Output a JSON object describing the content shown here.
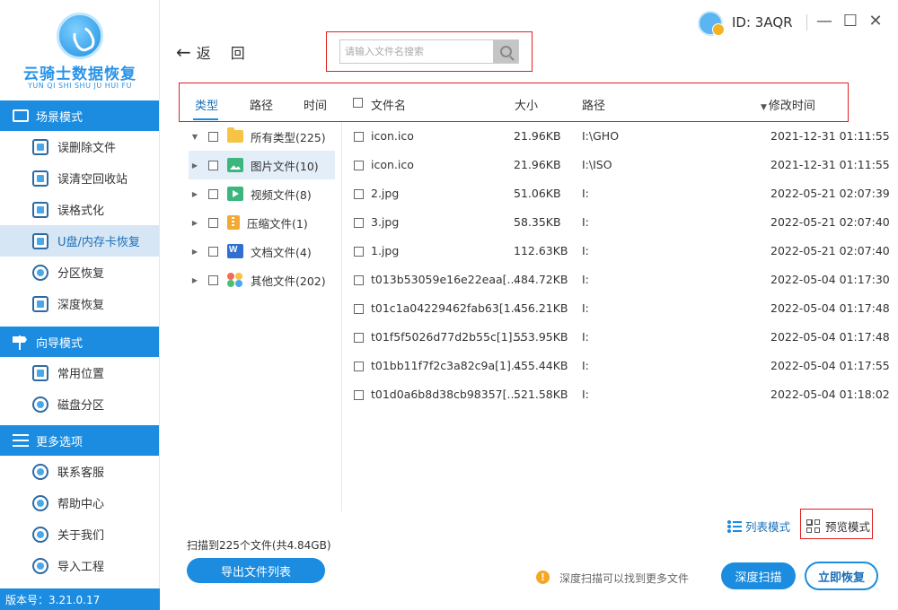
{
  "app": {
    "logo_title": "云骑士数据恢复",
    "logo_subtitle": "YUN QI SHI SHU JU HUI FU",
    "version": "版本号：3.21.0.17",
    "user_id": "ID: 3AQR"
  },
  "sidebar": {
    "sections": [
      {
        "title": "场景模式",
        "icon": "card-icon",
        "items": [
          {
            "label": "误删除文件",
            "icon": "deleted-file-icon",
            "active": false
          },
          {
            "label": "误清空回收站",
            "icon": "recycle-bin-icon",
            "active": false
          },
          {
            "label": "误格式化",
            "icon": "format-icon",
            "active": false
          },
          {
            "label": "U盘/内存卡恢复",
            "icon": "usb-card-icon",
            "active": true
          },
          {
            "label": "分区恢复",
            "icon": "partition-icon",
            "active": false
          },
          {
            "label": "深度恢复",
            "icon": "deep-recovery-icon",
            "active": false
          }
        ]
      },
      {
        "title": "向导模式",
        "icon": "signpost-icon",
        "items": [
          {
            "label": "常用位置",
            "icon": "common-location-icon",
            "active": false
          },
          {
            "label": "磁盘分区",
            "icon": "disk-partition-icon",
            "active": false
          }
        ]
      },
      {
        "title": "更多选项",
        "icon": "menu-icon",
        "items": [
          {
            "label": "联系客服",
            "icon": "customer-service-icon",
            "active": false
          },
          {
            "label": "帮助中心",
            "icon": "help-icon",
            "active": false
          },
          {
            "label": "关于我们",
            "icon": "info-icon",
            "active": false
          },
          {
            "label": "导入工程",
            "icon": "import-icon",
            "active": false
          }
        ]
      }
    ]
  },
  "toolbar": {
    "back_label": "返回",
    "search_placeholder": "请输入文件名搜索"
  },
  "filter_tabs": [
    "类型",
    "路径",
    "时间"
  ],
  "columns": {
    "name": "文件名",
    "size": "大小",
    "path": "路径",
    "modified": "修改时间"
  },
  "tree": [
    {
      "label": "所有类型(225)",
      "icon": "folder-icon",
      "expanded": true,
      "selected": false
    },
    {
      "label": "图片文件(10)",
      "icon": "image-icon",
      "expanded": false,
      "selected": true
    },
    {
      "label": "视频文件(8)",
      "icon": "video-icon",
      "expanded": false,
      "selected": false
    },
    {
      "label": "压缩文件(1)",
      "icon": "zip-icon",
      "expanded": false,
      "selected": false
    },
    {
      "label": "文档文件(4)",
      "icon": "document-icon",
      "expanded": false,
      "selected": false
    },
    {
      "label": "其他文件(202)",
      "icon": "other-files-icon",
      "expanded": false,
      "selected": false
    }
  ],
  "files": [
    {
      "name": "icon.ico",
      "size": "21.96KB",
      "path": "I:\\GHO",
      "modified": "2021-12-31 01:11:55"
    },
    {
      "name": "icon.ico",
      "size": "21.96KB",
      "path": "I:\\ISO",
      "modified": "2021-12-31 01:11:55"
    },
    {
      "name": "2.jpg",
      "size": "51.06KB",
      "path": "I:",
      "modified": "2022-05-21 02:07:39"
    },
    {
      "name": "3.jpg",
      "size": "58.35KB",
      "path": "I:",
      "modified": "2022-05-21 02:07:40"
    },
    {
      "name": "1.jpg",
      "size": "112.63KB",
      "path": "I:",
      "modified": "2022-05-21 02:07:40"
    },
    {
      "name": "t013b53059e16e22eaa[...",
      "size": "484.72KB",
      "path": "I:",
      "modified": "2022-05-04 01:17:30"
    },
    {
      "name": "t01c1a04229462fab63[1...",
      "size": "456.21KB",
      "path": "I:",
      "modified": "2022-05-04 01:17:48"
    },
    {
      "name": "t01f5f5026d77d2b55c[1]...",
      "size": "553.95KB",
      "path": "I:",
      "modified": "2022-05-04 01:17:48"
    },
    {
      "name": "t01bb11f7f2c3a82c9a[1]...",
      "size": "455.44KB",
      "path": "I:",
      "modified": "2022-05-04 01:17:55"
    },
    {
      "name": "t01d0a6b8d38cb98357[...",
      "size": "521.58KB",
      "path": "I:",
      "modified": "2022-05-04 01:18:02"
    }
  ],
  "view_modes": {
    "list": "列表模式",
    "preview": "预览模式"
  },
  "footer": {
    "scan_summary": "扫描到225个文件(共4.84GB)",
    "export_label": "导出文件列表",
    "tip_icon": "!",
    "tip_text": "深度扫描可以找到更多文件",
    "deep_scan_label": "深度扫描",
    "recover_label": "立即恢复"
  },
  "window_controls": {
    "minimize": "—",
    "maximize": "☐",
    "close": "✕"
  },
  "colors": {
    "accent": "#1b8ce0",
    "highlight_frame": "#e02020",
    "active_nav_bg": "#d6e6f5"
  }
}
